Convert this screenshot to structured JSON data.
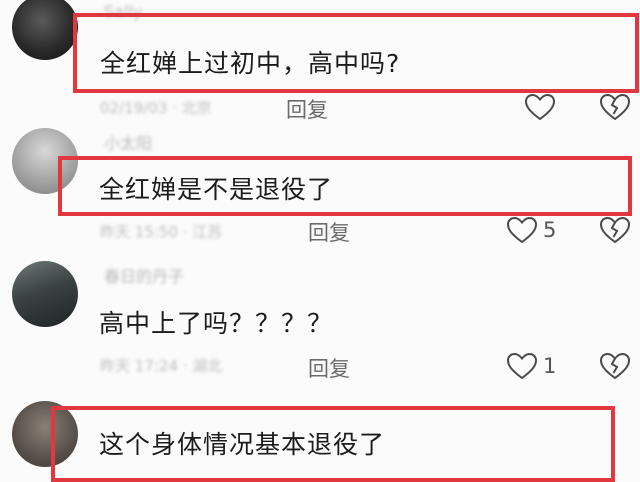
{
  "comments": [
    {
      "username": "Sally",
      "text": "全红婵上过初中，高中吗?",
      "meta": "02/19/03 · 北京",
      "reply_label": "回复",
      "like_count": ""
    },
    {
      "username": "小太阳",
      "text": "全红婵是不是退役了",
      "meta": "昨天 15:50 · 江苏",
      "reply_label": "回复",
      "like_count": "5"
    },
    {
      "username": "春日的丹子",
      "text": "高中上了吗？？？？",
      "meta": "昨天 17:24 · 湖北",
      "reply_label": "回复",
      "like_count": "1"
    },
    {
      "username": "",
      "text": "这个身体情况基本退役了",
      "meta": "",
      "reply_label": "",
      "like_count": ""
    }
  ],
  "colors": {
    "highlight": "#e0383e",
    "background": "#fbfbfb",
    "icon": "#4a4a4a"
  },
  "icons": [
    "heart-icon",
    "broken-heart-icon"
  ]
}
